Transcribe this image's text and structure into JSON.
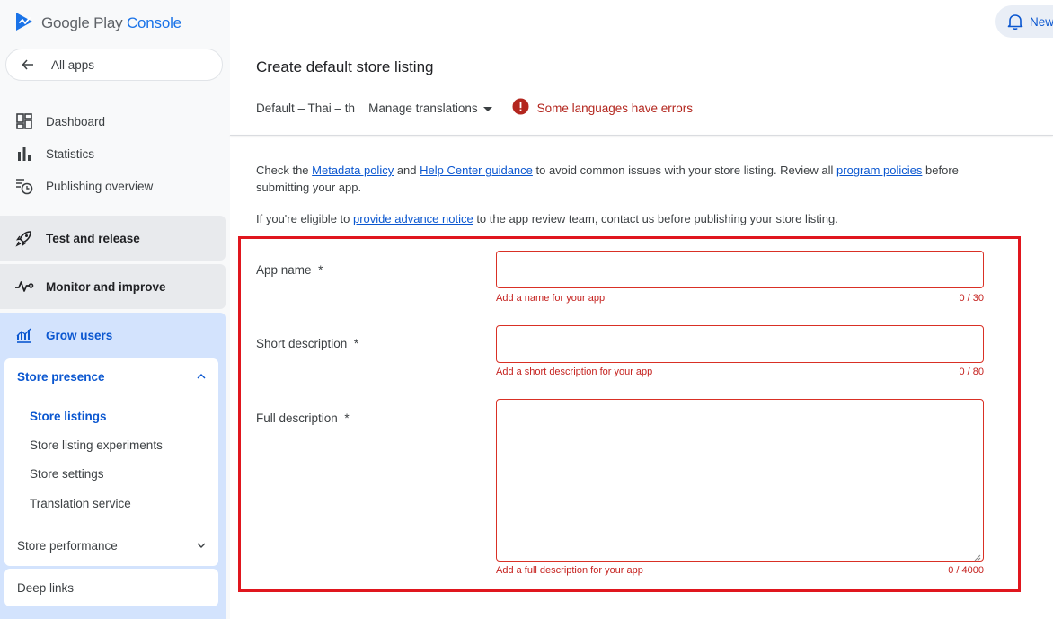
{
  "app": {
    "logo_text_main": "Google Play",
    "logo_text_accent": "Console",
    "logo_icon": "play-console-logo-icon"
  },
  "sidebar": {
    "back_label": "All apps",
    "items": [
      {
        "label": "Dashboard",
        "icon": "dashboard-icon"
      },
      {
        "label": "Statistics",
        "icon": "bar-chart-icon"
      },
      {
        "label": "Publishing overview",
        "icon": "publishing-overview-icon"
      }
    ],
    "sections": [
      {
        "label": "Test and release",
        "icon": "rocket-icon"
      },
      {
        "label": "Monitor and improve",
        "icon": "vitals-icon"
      }
    ],
    "grow": {
      "label": "Grow users",
      "icon": "grow-users-icon",
      "store_presence": {
        "label": "Store presence",
        "items": [
          "Store listings",
          "Store listing experiments",
          "Store settings",
          "Translation service"
        ],
        "active": "Store listings"
      },
      "store_performance": "Store performance",
      "deep_links": "Deep links"
    }
  },
  "header": {
    "notifications_label": "New",
    "title": "Create default store listing",
    "language": "Default – Thai – th",
    "manage_translations": "Manage translations",
    "error_text": "Some languages have errors"
  },
  "intro": {
    "p1": {
      "t1": "Check the ",
      "link1": "Metadata policy",
      "t2": " and ",
      "link2": "Help Center guidance",
      "t3": " to avoid common issues with your store listing. Review all ",
      "link3": "program policies",
      "t4": " before submitting your app."
    },
    "p2": {
      "t1": "If you're eligible to ",
      "link1": "provide advance notice",
      "t2": " to the app review team, contact us before publishing your store listing."
    }
  },
  "form": {
    "app_name": {
      "label": "App name",
      "required": "*",
      "hint": "Add a name for your app",
      "count": "0 / 30",
      "value": ""
    },
    "short_description": {
      "label": "Short description",
      "required": "*",
      "hint": "Add a short description for your app",
      "count": "0 / 80",
      "value": ""
    },
    "full_description": {
      "label": "Full description",
      "required": "*",
      "hint": "Add a full description for your app",
      "count": "0 / 4000",
      "value": ""
    }
  },
  "colors": {
    "accent": "#0b57d0",
    "error": "#c5221f",
    "highlight": "#e0161e"
  }
}
